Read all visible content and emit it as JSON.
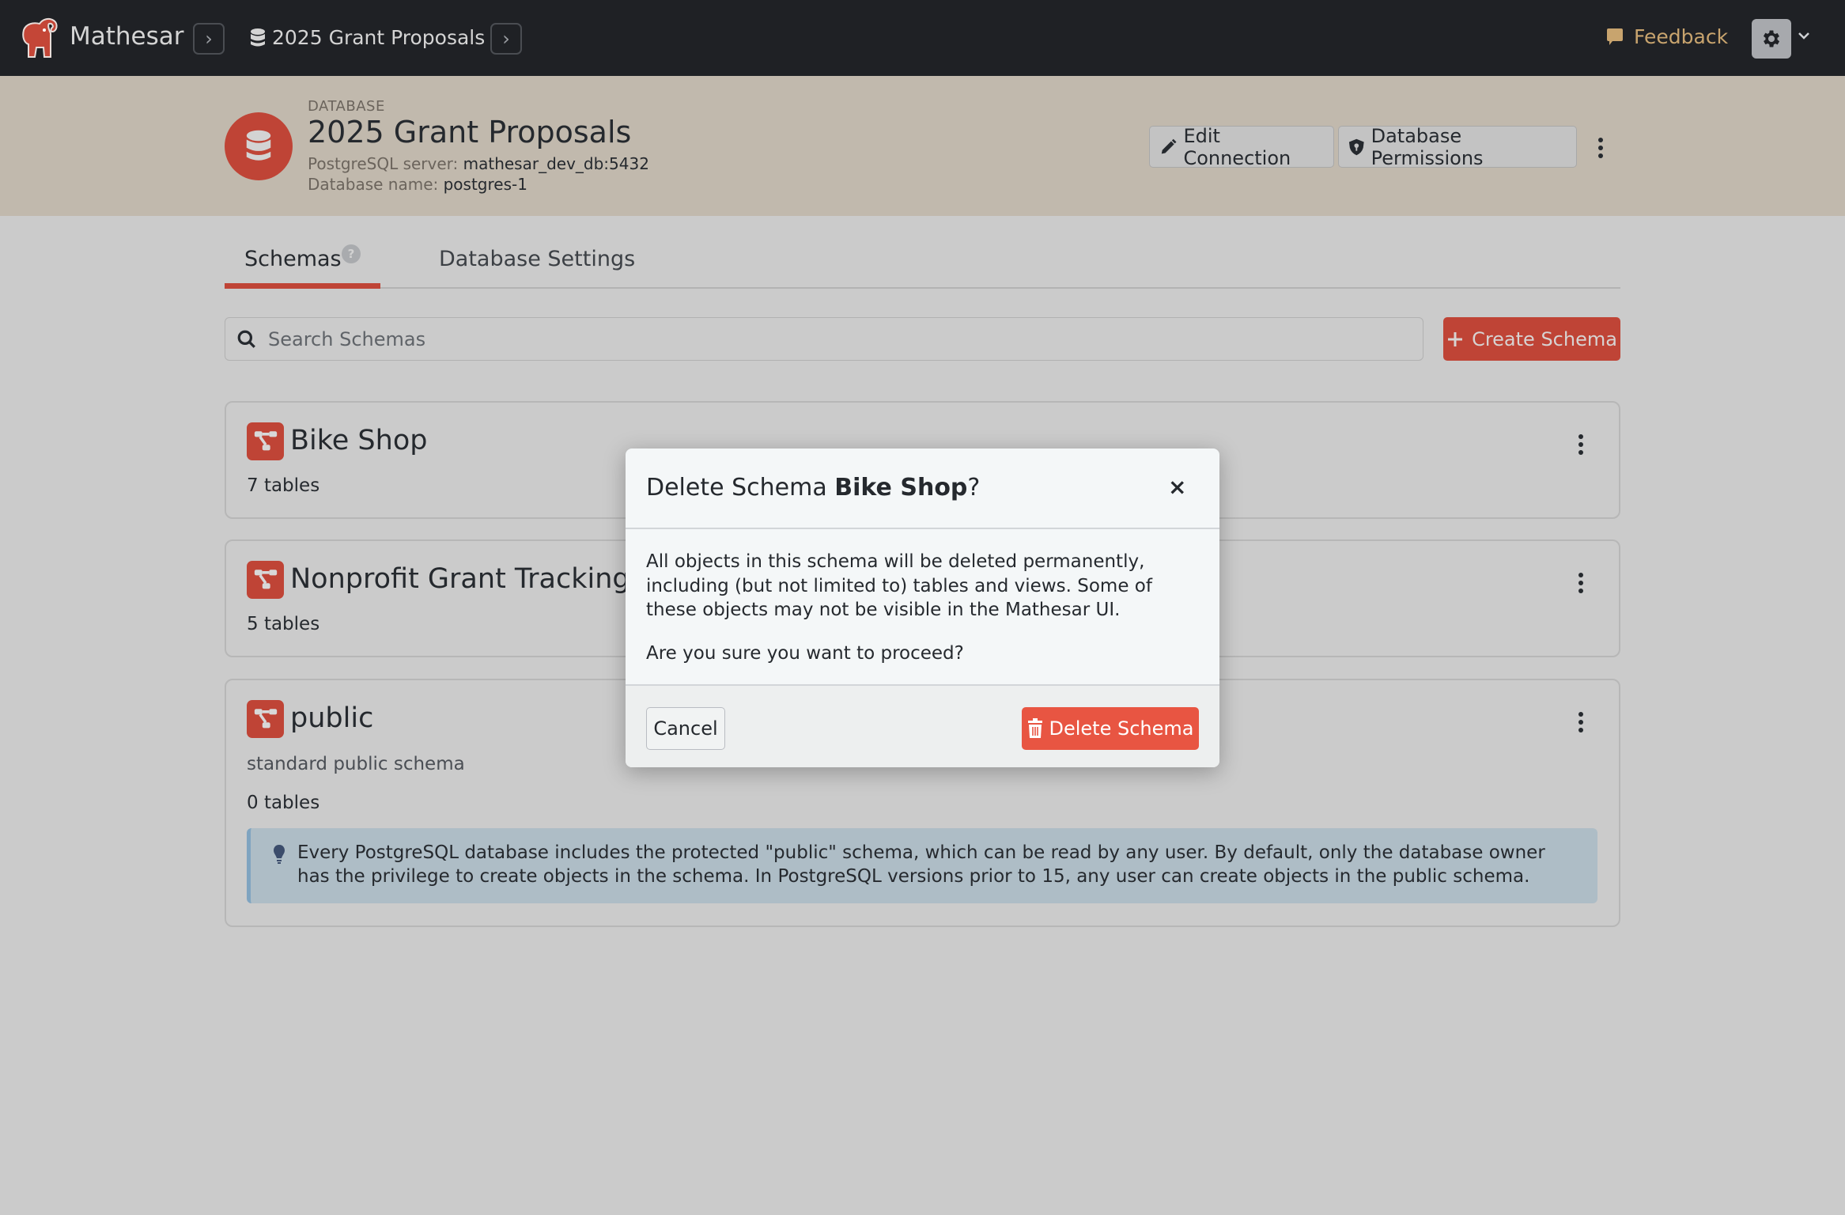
{
  "topbar": {
    "app_name": "Mathesar",
    "breadcrumb_database": "2025 Grant Proposals",
    "feedback_label": "Feedback",
    "icons": {
      "logo": "mathesar-elephant-logo",
      "breadcrumb_separator": "chevron-right-icon",
      "database": "database-icon",
      "feedback": "comment-icon",
      "settings": "gear-icon",
      "settings_dropdown": "chevron-down-icon"
    }
  },
  "header": {
    "label": "DATABASE",
    "title": "2025 Grant Proposals",
    "server_label": "PostgreSQL server:",
    "server_value": "mathesar_dev_db:5432",
    "dbname_label": "Database name:",
    "dbname_value": "postgres-1",
    "edit_connection_label": "Edit Connection",
    "permissions_label": "Database Permissions"
  },
  "tabs": [
    {
      "label": "Schemas",
      "active": true,
      "has_help": true
    },
    {
      "label": "Database Settings",
      "active": false
    }
  ],
  "help_glyph": "?",
  "search": {
    "placeholder": "Search Schemas",
    "value": ""
  },
  "create_schema_label": "Create Schema",
  "schemas": [
    {
      "name": "Bike Shop",
      "description": "",
      "table_count": "7 tables"
    },
    {
      "name": "Nonprofit Grant Tracking",
      "description": "",
      "table_count": "5 tables"
    },
    {
      "name": "public",
      "description": "standard public schema",
      "table_count": "0 tables",
      "info": "Every PostgreSQL database includes the protected \"public\" schema, which can be read by any user. By default, only the database owner has the privilege to create objects in the schema. In PostgreSQL versions prior to 15, any user can create objects in the public schema."
    }
  ],
  "modal": {
    "title_prefix": "Delete Schema ",
    "title_schema": "Bike Shop",
    "title_suffix": "?",
    "close_glyph": "×",
    "body_p1": "All objects in this schema will be deleted permanently, including (but not limited to) tables and views. Some of these objects may not be visible in the Mathesar UI.",
    "body_p2": "Are you sure you want to proceed?",
    "cancel_label": "Cancel",
    "delete_label": "Delete Schema"
  },
  "colors": {
    "brand_red": "#bf4436",
    "danger": "#e85542",
    "topbar": "#1f2125",
    "feedback": "#c8a46e",
    "header_band": "#c1b9ad",
    "info_box": "#aebdc6"
  }
}
